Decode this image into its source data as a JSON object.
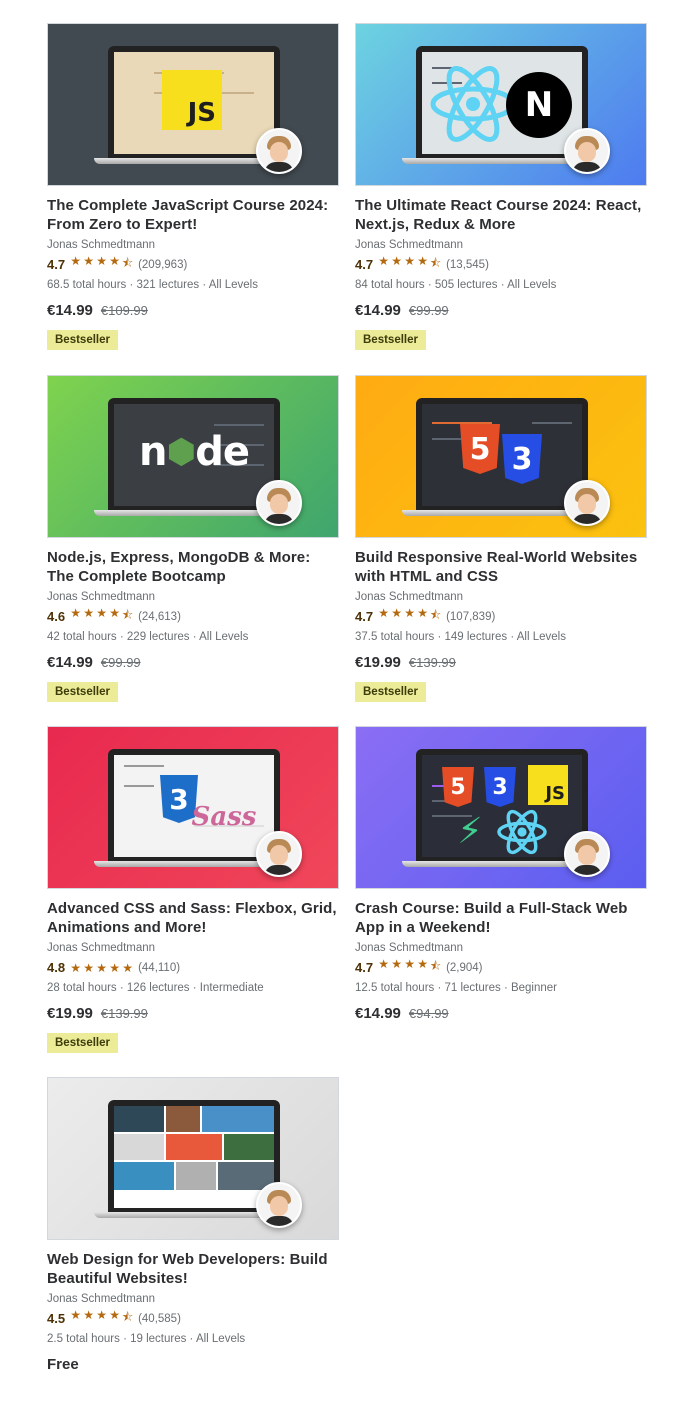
{
  "instructor": "Jonas Schmedtmann",
  "courses": [
    {
      "title": "The Complete JavaScript Course 2024: From Zero to Expert!",
      "rating": "4.7",
      "stars": 4.5,
      "count": "(209,963)",
      "meta": "68.5 total hours · 321 lectures · All Levels",
      "price": "€14.99",
      "orig": "€109.99",
      "badge": "Bestseller",
      "logo": "JS"
    },
    {
      "title": "The Ultimate React Course 2024: React, Next.js, Redux & More",
      "rating": "4.7",
      "stars": 4.5,
      "count": "(13,545)",
      "meta": "84 total hours · 505 lectures · All Levels",
      "price": "€14.99",
      "orig": "€99.99",
      "badge": "Bestseller",
      "logo": "N"
    },
    {
      "title": "Node.js, Express, MongoDB & More: The Complete Bootcamp",
      "rating": "4.6",
      "stars": 4.5,
      "count": "(24,613)",
      "meta": "42 total hours · 229 lectures · All Levels",
      "price": "€14.99",
      "orig": "€99.99",
      "badge": "Bestseller",
      "logo": "node"
    },
    {
      "title": "Build Responsive Real-World Websites with HTML and CSS",
      "rating": "4.7",
      "stars": 4.5,
      "count": "(107,839)",
      "meta": "37.5 total hours · 149 lectures · All Levels",
      "price": "€19.99",
      "orig": "€139.99",
      "badge": "Bestseller",
      "logo": "5"
    },
    {
      "title": "Advanced CSS and Sass: Flexbox, Grid, Animations and More!",
      "rating": "4.8",
      "stars": 5,
      "count": "(44,110)",
      "meta": "28 total hours · 126 lectures · Intermediate",
      "price": "€19.99",
      "orig": "€139.99",
      "badge": "Bestseller",
      "logo": "Sass"
    },
    {
      "title": "Crash Course: Build a Full-Stack Web App in a Weekend!",
      "rating": "4.7",
      "stars": 4.5,
      "count": "(2,904)",
      "meta": "12.5 total hours · 71 lectures · Beginner",
      "price": "€14.99",
      "orig": "€94.99",
      "badge": "",
      "logo": "JS"
    },
    {
      "title": "Web Design for Web Developers: Build Beautiful Websites!",
      "rating": "4.5",
      "stars": 4.5,
      "count": "(40,585)",
      "meta": "2.5 total hours · 19 lectures · All Levels",
      "price": "Free",
      "orig": "",
      "badge": "",
      "logo": ""
    }
  ],
  "colors": {
    "thumb_bg": [
      "#414a50",
      "#5b9ee9",
      "#4fb465",
      "#fdb40a",
      "#ec3d57",
      "#7a6ef2",
      "#e4e4e4"
    ],
    "star": "#b4690e",
    "badge_bg": "#eceb98"
  },
  "icons": {
    "star_full": "★",
    "star_half": "⯪"
  }
}
